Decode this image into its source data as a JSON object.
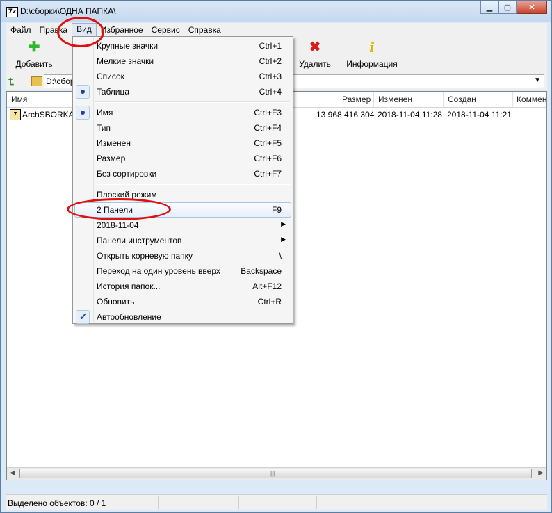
{
  "window": {
    "title": "D:\\сборки\\ОДНА ПАПКА\\",
    "app_icon_text": "7z"
  },
  "menubar": [
    "Файл",
    "Правка",
    "Вид",
    "Избранное",
    "Сервис",
    "Справка"
  ],
  "toolbar": {
    "add_label": "Добавить",
    "delete_label": "Удалить",
    "info_label": "Информация"
  },
  "address": {
    "path": "D:\\сборки\\ОДНА ПАПКА\\"
  },
  "columns": {
    "name": "Имя",
    "size": "Размер",
    "modified": "Изменен",
    "created": "Создан",
    "comment": "Комментарий"
  },
  "file": {
    "name": "ArchSBORKA-2018-11-04.7z",
    "size": "13 968 416 304",
    "modified": "2018-11-04 11:28",
    "created": "2018-11-04 11:21"
  },
  "status": {
    "selected": "Выделено объектов: 0 / 1"
  },
  "view_menu": {
    "group1": [
      {
        "label": "Крупные значки",
        "shortcut": "Ctrl+1"
      },
      {
        "label": "Мелкие значки",
        "shortcut": "Ctrl+2"
      },
      {
        "label": "Список",
        "shortcut": "Ctrl+3"
      },
      {
        "label": "Таблица",
        "shortcut": "Ctrl+4"
      }
    ],
    "group2": [
      {
        "label": "Имя",
        "shortcut": "Ctrl+F3"
      },
      {
        "label": "Тип",
        "shortcut": "Ctrl+F4"
      },
      {
        "label": "Изменен",
        "shortcut": "Ctrl+F5"
      },
      {
        "label": "Размер",
        "shortcut": "Ctrl+F6"
      },
      {
        "label": "Без сортировки",
        "shortcut": "Ctrl+F7"
      }
    ],
    "group3": [
      {
        "label": "Плоский режим",
        "shortcut": ""
      },
      {
        "label": "2 Панели",
        "shortcut": "F9"
      },
      {
        "label": "2018-11-04",
        "shortcut": ""
      },
      {
        "label": "Панели инструментов",
        "shortcut": ""
      },
      {
        "label": "Открыть корневую папку",
        "shortcut": "\\"
      },
      {
        "label": "Переход на один уровень вверх",
        "shortcut": "Backspace"
      },
      {
        "label": "История папок...",
        "shortcut": "Alt+F12"
      },
      {
        "label": "Обновить",
        "shortcut": "Ctrl+R"
      },
      {
        "label": "Автообновление",
        "shortcut": ""
      }
    ]
  },
  "colors": {
    "highlight_ellipse": "#e01010",
    "add_icon": "#2fb82f",
    "delete_icon": "#d81b1b",
    "info_icon": "#e0b600"
  },
  "icons": {
    "add": "plus-icon",
    "delete": "x-icon",
    "info": "info-icon",
    "up": "arrow-up-icon",
    "folder": "folder-icon"
  }
}
